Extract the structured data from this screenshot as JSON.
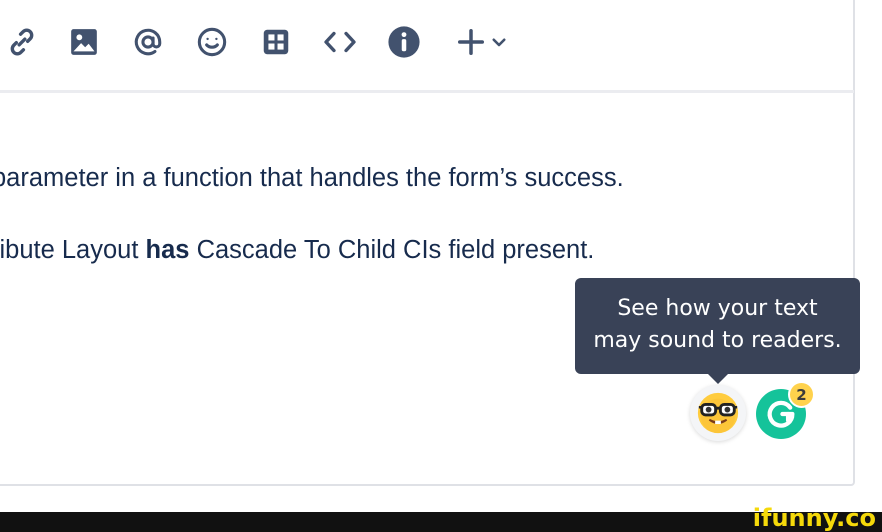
{
  "toolbar": {
    "buttons": [
      {
        "icon": "link-icon"
      },
      {
        "icon": "image-icon"
      },
      {
        "icon": "mention-icon"
      },
      {
        "icon": "emoji-icon"
      },
      {
        "icon": "table-icon"
      },
      {
        "icon": "code-icon"
      },
      {
        "icon": "info-icon"
      },
      {
        "icon": "plus-icon",
        "has_dropdown": true
      }
    ]
  },
  "content": {
    "line1": "parameter in a function that handles the form’s success.",
    "line2_pre": "ribute Layout ",
    "line2_bold": "has",
    "line2_post": " Cascade To Child CIs field present."
  },
  "tooltip": {
    "line1": "See how your text",
    "line2": "may sound to readers."
  },
  "grammarly": {
    "badge_count": "2",
    "tone_icon": "nerd-face-emoji-icon",
    "logo_icon": "grammarly-g-icon",
    "brand_color": "#15c39a"
  },
  "watermark": {
    "text": "ifunny.co"
  },
  "colors": {
    "text": "#172b4d",
    "icon": "#42526e",
    "tooltip_bg": "#394257"
  }
}
